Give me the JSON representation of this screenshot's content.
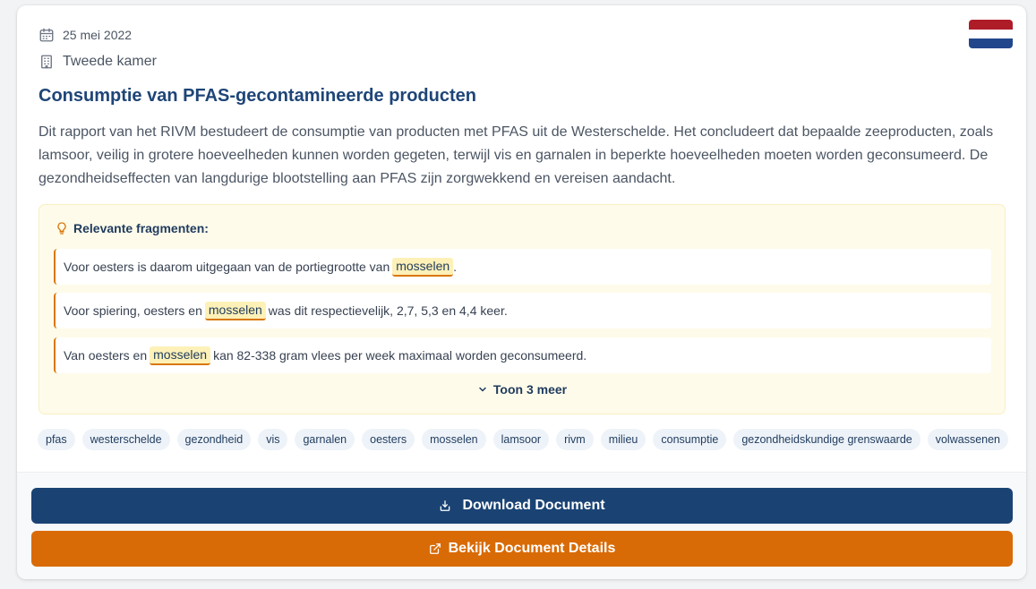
{
  "document": {
    "date": "25 mei 2022",
    "chamber": "Tweede kamer",
    "title": "Consumptie van PFAS-gecontamineerde producten",
    "summary": "Dit rapport van het RIVM bestudeert de consumptie van producten met PFAS uit de Westerschelde. Het concludeert dat bepaalde zeeproducten, zoals lamsoor, veilig in grotere hoeveelheden kunnen worden gegeten, terwijl vis en garnalen in beperkte hoeveelheden moeten worden geconsumeerd. De gezondheidseffecten van langdurige blootstelling aan PFAS zijn zorgwekkend en vereisen aandacht.",
    "flag": "netherlands-flag",
    "icons": {
      "date": "calendar-icon",
      "chamber": "building-icon"
    }
  },
  "fragments": {
    "heading": "Relevante fragmenten:",
    "icon": "lightbulb-icon",
    "items": [
      {
        "before": "Voor oesters is daarom uitgegaan van de portiegrootte van",
        "highlight": "mosselen",
        "after": "."
      },
      {
        "before": "Voor spiering, oesters en",
        "highlight": "mosselen",
        "after": "was dit respectievelijk, 2,7, 5,3 en 4,4 keer."
      },
      {
        "before": "Van oesters en",
        "highlight": "mosselen",
        "after": "kan 82-338 gram vlees per week maximaal worden geconsumeerd."
      }
    ],
    "show_more_label": "Toon 3 meer"
  },
  "tags": [
    "pfas",
    "westerschelde",
    "gezondheid",
    "vis",
    "garnalen",
    "oesters",
    "mosselen",
    "lamsoor",
    "rivm",
    "milieu",
    "consumptie",
    "gezondheidskundige grenswaarde",
    "volwassenen"
  ],
  "actions": {
    "download_label": "Download Document",
    "details_label": "Bekijk Document Details"
  },
  "colors": {
    "primary": "#1a4374",
    "accent": "#d96b06",
    "title": "#1e4577",
    "fragment_bg": "#fefbea",
    "highlight_bg": "#fdf1b8"
  }
}
